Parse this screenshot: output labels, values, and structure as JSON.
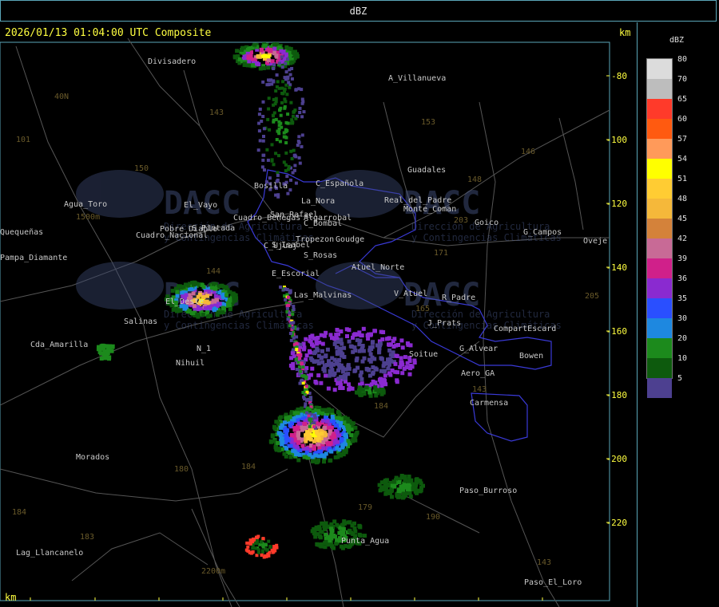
{
  "header": {
    "title": "dBZ"
  },
  "map": {
    "timestamp": "2026/01/13 01:04:00 UTC Composite",
    "unit_top": "km",
    "unit_bottom": "km",
    "x_ticks": [
      "-20",
      "0",
      "20",
      "40",
      "60",
      "80",
      "100",
      "120",
      "140"
    ],
    "y_ticks": [
      "-80",
      "-100",
      "-120",
      "-140",
      "-160",
      "-180",
      "-200",
      "-220"
    ],
    "watermark_brand": "DACC",
    "watermark_line1": "Dirección de Agricultura",
    "watermark_line2": "y Contingencias Climáticas",
    "places": [
      "Divisadero",
      "A_Villanueva",
      "Guadales",
      "C_Española",
      "La_Nora",
      "Agua_Toro",
      "Goico",
      "G_Campos",
      "Oveje",
      "Pampa_Diamante",
      "S_Pintada",
      "C_Bombal",
      "Tropezon",
      "Goudge",
      "S_Rosas",
      "E_Escorial",
      "Atuel_Norte",
      "V_Atuel",
      "R_Padre",
      "Las_Malvinas",
      "Salinas",
      "El_Deste",
      "J_Prats",
      "CompartEscard",
      "Cda_Amarilla",
      "Nihuil",
      "G_Alvear",
      "Bowen",
      "Soitue",
      "Aero_GA",
      "Carmensa",
      "Morados",
      "Paso_Burroso",
      "Punta_Agua",
      "Lag_Llancanelo",
      "Paso_El_Loro",
      "Bosilla",
      "Cuadro_Benegas",
      "San_Rafael",
      "Monte_Coman",
      "Real_del_Padre",
      "Cuadro_Nacional",
      "C_Ujuaj",
      "El_Vayo",
      "N_1",
      "Algarrobal",
      "Pobre_Diablo",
      "S_Isabel",
      "Quequeñas"
    ],
    "route_labels": [
      "143",
      "153",
      "146",
      "148",
      "150",
      "101",
      "40N",
      "203",
      "171",
      "144",
      "165",
      "205",
      "184",
      "143",
      "179",
      "190",
      "180",
      "184",
      "183",
      "184",
      "143"
    ],
    "elevation_labels": [
      "1500m",
      "2200m"
    ]
  },
  "legend": {
    "title": "dBZ",
    "items": [
      {
        "label": "80",
        "color": "#dcdcdc"
      },
      {
        "label": "70",
        "color": "#bdbdbd"
      },
      {
        "label": "65",
        "color": "#ff3a2a"
      },
      {
        "label": "60",
        "color": "#ff5a10"
      },
      {
        "label": "57",
        "color": "#ff9a5a"
      },
      {
        "label": "54",
        "color": "#ffff00"
      },
      {
        "label": "51",
        "color": "#ffcc33"
      },
      {
        "label": "48",
        "color": "#f5b83a"
      },
      {
        "label": "45",
        "color": "#d4823a"
      },
      {
        "label": "42",
        "color": "#c86a96"
      },
      {
        "label": "39",
        "color": "#d0208a"
      },
      {
        "label": "36",
        "color": "#8a2ad0"
      },
      {
        "label": "35",
        "color": "#2a4fff"
      },
      {
        "label": "30",
        "color": "#1e88e0"
      },
      {
        "label": "20",
        "color": "#1c8a1c"
      },
      {
        "label": "10",
        "color": "#0d5a0d"
      },
      {
        "label": "5",
        "color": "#4d4090"
      }
    ]
  }
}
